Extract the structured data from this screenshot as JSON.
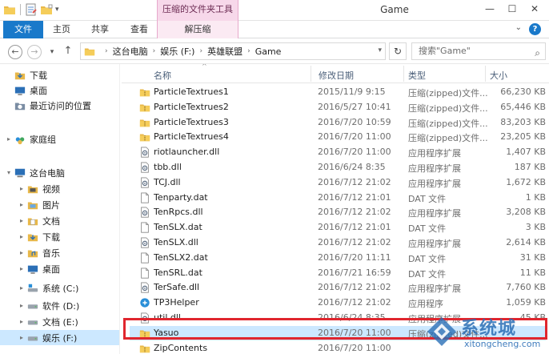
{
  "window": {
    "title": "Game",
    "tool_tab_header": "压缩的文件夹工具",
    "minimize_glyph": "—",
    "maximize_glyph": "☐",
    "close_glyph": "✕"
  },
  "ribbon": {
    "tabs": [
      {
        "label": "文件"
      },
      {
        "label": "主页"
      },
      {
        "label": "共享"
      },
      {
        "label": "查看"
      },
      {
        "label": "解压缩"
      }
    ],
    "expand_glyph": "⌄",
    "help_glyph": "?"
  },
  "navigation": {
    "back_glyph": "←",
    "forward_glyph": "→",
    "recent_glyph": "▾",
    "up_glyph": "↑",
    "breadcrumbs": [
      "这台电脑",
      "娱乐 (F:)",
      "英雄联盟",
      "Game"
    ],
    "chevron_glyph": "›",
    "dropdown_glyph": "▾",
    "refresh_glyph": "↻",
    "search_placeholder": "搜索\"Game\"",
    "search_glyph": "⌕"
  },
  "sidebar": {
    "items": [
      {
        "label": "下载",
        "icon": "download-folder-icon"
      },
      {
        "label": "桌面",
        "icon": "desktop-icon"
      },
      {
        "label": "最近访问的位置",
        "icon": "recent-places-icon"
      },
      {
        "label": "家庭组",
        "icon": "homegroup-icon"
      },
      {
        "label": "这台电脑",
        "icon": "this-pc-icon"
      },
      {
        "label": "视频",
        "icon": "videos-folder-icon"
      },
      {
        "label": "图片",
        "icon": "pictures-folder-icon"
      },
      {
        "label": "文档",
        "icon": "documents-folder-icon"
      },
      {
        "label": "下载",
        "icon": "download-folder-icon"
      },
      {
        "label": "音乐",
        "icon": "music-folder-icon"
      },
      {
        "label": "桌面",
        "icon": "desktop-icon"
      },
      {
        "label": "系统 (C:)",
        "icon": "system-drive-icon"
      },
      {
        "label": "软件 (D:)",
        "icon": "drive-icon"
      },
      {
        "label": "文档 (E:)",
        "icon": "drive-icon"
      },
      {
        "label": "娱乐 (F:)",
        "icon": "drive-icon"
      }
    ]
  },
  "columns": {
    "name": "名称",
    "date": "修改日期",
    "type": "类型",
    "size": "大小",
    "sort_glyph": "^"
  },
  "files": [
    {
      "name": "ParticleTextrues1",
      "date": "2015/11/9 9:15",
      "type": "压缩(zipped)文件...",
      "size": "66,230 KB",
      "icon": "zip-folder-icon"
    },
    {
      "name": "ParticleTextrues2",
      "date": "2016/5/27 10:41",
      "type": "压缩(zipped)文件...",
      "size": "65,446 KB",
      "icon": "zip-folder-icon"
    },
    {
      "name": "ParticleTextrues3",
      "date": "2016/7/20 10:59",
      "type": "压缩(zipped)文件...",
      "size": "83,203 KB",
      "icon": "zip-folder-icon"
    },
    {
      "name": "ParticleTextrues4",
      "date": "2016/7/20 11:00",
      "type": "压缩(zipped)文件...",
      "size": "23,205 KB",
      "icon": "zip-folder-icon"
    },
    {
      "name": "riotlauncher.dll",
      "date": "2016/7/20 11:00",
      "type": "应用程序扩展",
      "size": "1,407 KB",
      "icon": "dll-file-icon"
    },
    {
      "name": "tbb.dll",
      "date": "2016/6/24 8:35",
      "type": "应用程序扩展",
      "size": "187 KB",
      "icon": "dll-file-icon"
    },
    {
      "name": "TCJ.dll",
      "date": "2016/7/12 21:02",
      "type": "应用程序扩展",
      "size": "1,672 KB",
      "icon": "dll-file-icon"
    },
    {
      "name": "Tenparty.dat",
      "date": "2016/7/12 21:01",
      "type": "DAT 文件",
      "size": "1 KB",
      "icon": "file-icon"
    },
    {
      "name": "TenRpcs.dll",
      "date": "2016/7/12 21:02",
      "type": "应用程序扩展",
      "size": "3,208 KB",
      "icon": "dll-file-icon"
    },
    {
      "name": "TenSLX.dat",
      "date": "2016/7/12 21:01",
      "type": "DAT 文件",
      "size": "3 KB",
      "icon": "file-icon"
    },
    {
      "name": "TenSLX.dll",
      "date": "2016/7/12 21:02",
      "type": "应用程序扩展",
      "size": "2,614 KB",
      "icon": "dll-file-icon"
    },
    {
      "name": "TenSLX2.dat",
      "date": "2016/7/20 11:11",
      "type": "DAT 文件",
      "size": "31 KB",
      "icon": "file-icon"
    },
    {
      "name": "TenSRL.dat",
      "date": "2016/7/21 16:59",
      "type": "DAT 文件",
      "size": "11 KB",
      "icon": "file-icon"
    },
    {
      "name": "TerSafe.dll",
      "date": "2016/7/12 21:02",
      "type": "应用程序扩展",
      "size": "7,760 KB",
      "icon": "dll-file-icon"
    },
    {
      "name": "TP3Helper",
      "date": "2016/7/12 21:02",
      "type": "应用程序",
      "size": "1,059 KB",
      "icon": "app-icon"
    },
    {
      "name": "util.dll",
      "date": "2016/6/24 8:35",
      "type": "应用程序扩展",
      "size": "45 KB",
      "icon": "dll-file-icon"
    },
    {
      "name": "Yasuo",
      "date": "2016/7/20 11:00",
      "type": "压缩(zipped)文件...",
      "size": "",
      "icon": "zip-folder-icon"
    },
    {
      "name": "ZipContents",
      "date": "2016/7/20 11:00",
      "type": "",
      "size": "",
      "icon": "zip-folder-icon"
    }
  ],
  "watermark": {
    "brand": "系统城",
    "url": "xitongcheng.com"
  },
  "colors": {
    "accent": "#1979ca",
    "selection": "#cce8ff",
    "tool_tab": "#f7d8ea",
    "highlight": "#e0262e"
  }
}
